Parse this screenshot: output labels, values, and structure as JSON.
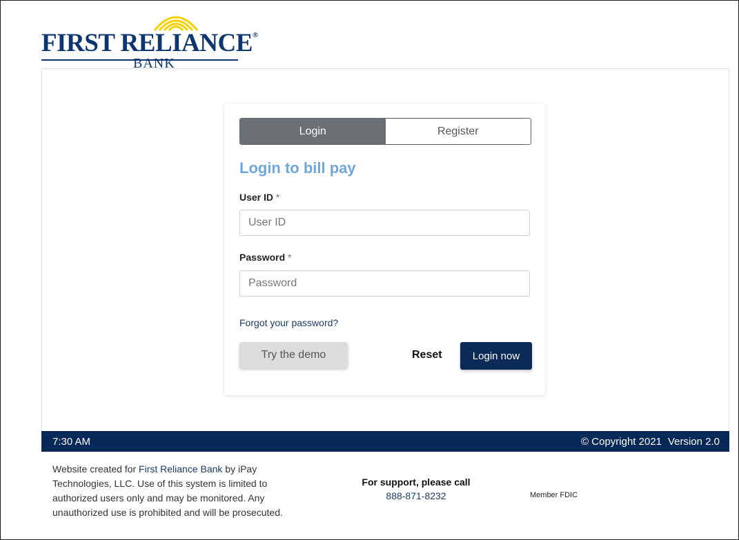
{
  "brand": {
    "name_line": "FIRST RELIANCE",
    "registered_mark": "®",
    "sub_line": "BANK",
    "primary_color": "#0d3670",
    "accent_color": "#f5d000"
  },
  "tabs": {
    "login": "Login",
    "register": "Register"
  },
  "form": {
    "title": "Login to bill pay",
    "user_id_label": "User ID",
    "user_id_placeholder": "User ID",
    "user_id_value": "",
    "password_label": "Password",
    "password_placeholder": "Password",
    "password_value": "",
    "required_marker": "*",
    "forgot_link": "Forgot your password?",
    "demo_button": "Try the demo",
    "reset_button": "Reset",
    "login_button": "Login now"
  },
  "footer": {
    "time": "7:30 AM",
    "copyright": "© Copyright 2021",
    "version": "Version 2.0",
    "bar_color": "#062957"
  },
  "disclaimer": {
    "prefix": "Website created for ",
    "bank_link": "First Reliance Bank",
    "suffix": " by iPay Technologies, LLC. Use of this system is limited to authorized users only and may be monitored. Any unauthorized use is prohibited and will be prosecuted."
  },
  "support": {
    "label": "For support, please call",
    "phone": "888-871-8232"
  },
  "fdic": "Member FDIC"
}
